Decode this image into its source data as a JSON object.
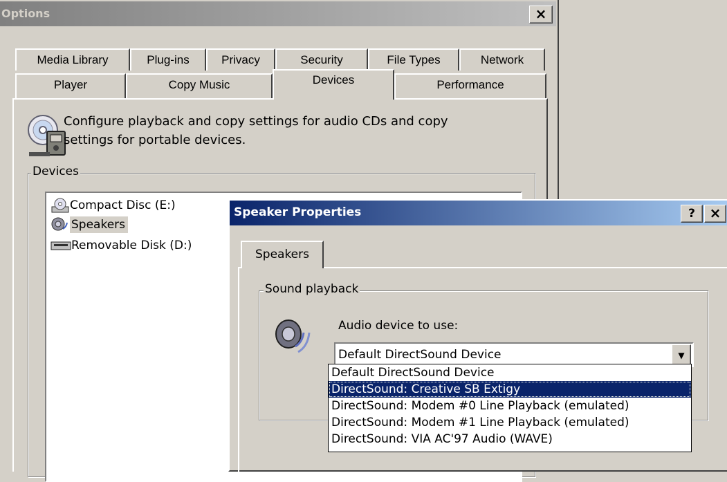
{
  "options": {
    "title": "Options",
    "close_glyph": "×",
    "tabs_row1": [
      "Media Library",
      "Plug-ins",
      "Privacy",
      "Security",
      "File Types",
      "Network"
    ],
    "tabs_row2": [
      "Player",
      "Copy Music",
      "Devices",
      "Performance"
    ],
    "active_tab": "Devices",
    "description": "Configure playback and copy settings for audio CDs and copy settings for portable devices.",
    "devices_group_label": "Devices",
    "devices": [
      {
        "label": "Compact Disc (E:)",
        "icon": "cd-drive-icon"
      },
      {
        "label": "Speakers",
        "icon": "speaker-icon"
      },
      {
        "label": "Removable Disk (D:)",
        "icon": "removable-disk-icon"
      }
    ]
  },
  "speaker": {
    "title": "Speaker Properties",
    "help_glyph": "?",
    "close_glyph": "×",
    "tab": "Speakers",
    "group_label": "Sound playback",
    "audio_label": "Audio device to use:",
    "selected": "Default DirectSound Device",
    "options": [
      "Default DirectSound Device",
      "DirectSound: Creative SB Extigy",
      "DirectSound: Modem #0 Line Playback (emulated)",
      "DirectSound: Modem #1 Line Playback (emulated)",
      "DirectSound: VIA AC'97 Audio (WAVE)"
    ],
    "highlighted_option": "DirectSound: Creative SB Extigy"
  },
  "colors": {
    "face": "#d4d0c8",
    "active_title": "#0a246a",
    "inactive_title": "#808080",
    "highlight": "#0a246a"
  }
}
